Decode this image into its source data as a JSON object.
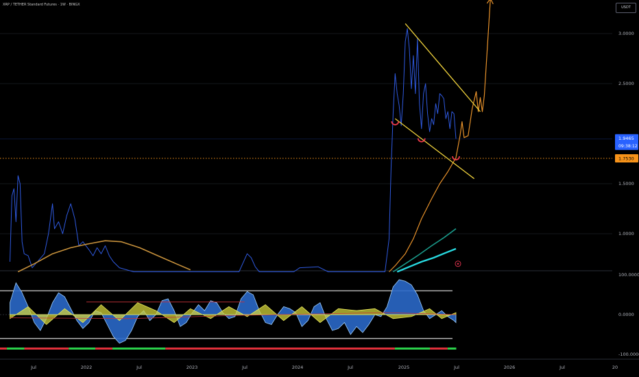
{
  "header": {
    "symbol_title": "XRP / TETHER Standard Futures · 1W · BINGX",
    "currency_button": "USDT"
  },
  "price_axis": {
    "ticks": [
      "3.0000",
      "2.5000",
      "1.5000",
      "1.0000"
    ],
    "current_price": "1.9465",
    "countdown": "09:38:12",
    "level_label": "1.7530",
    "colors": {
      "current": "#2962ff",
      "level": "#f7931a"
    }
  },
  "osc_axis": {
    "ticks": [
      "100.0000",
      "0.0000",
      "-100.0000"
    ]
  },
  "time_axis": {
    "ticks": [
      "Jul",
      "2022",
      "Jul",
      "2023",
      "Jul",
      "2024",
      "Jul",
      "2025",
      "Jul",
      "2026",
      "Jul",
      "20"
    ]
  },
  "chart_data": [
    {
      "type": "line",
      "panel": "price",
      "y_ticks": [
        1.0,
        1.5,
        2.5,
        3.0
      ],
      "ylim": [
        0.65,
        3.35
      ],
      "x_range": [
        "2021-04",
        "2026-12"
      ],
      "series": [
        {
          "color": "#2f5ae0",
          "values": [
            [
              "2021-04-12",
              0.72
            ],
            [
              "2021-04-19",
              1.38
            ],
            [
              "2021-04-26",
              1.45
            ],
            [
              "2021-05-03",
              1.12
            ],
            [
              "2021-05-10",
              1.58
            ],
            [
              "2021-05-17",
              1.5
            ],
            [
              "2021-05-24",
              0.92
            ],
            [
              "2021-05-31",
              0.8
            ],
            [
              "2021-06-14",
              0.78
            ],
            [
              "2021-06-28",
              0.66
            ],
            [
              "2021-08-09",
              0.8
            ],
            [
              "2021-08-23",
              1.0
            ],
            [
              "2021-09-06",
              1.3
            ],
            [
              "2021-09-13",
              1.05
            ],
            [
              "2021-09-27",
              1.12
            ],
            [
              "2021-10-11",
              1.0
            ],
            [
              "2021-10-25",
              1.18
            ],
            [
              "2021-11-08",
              1.3
            ],
            [
              "2021-11-22",
              1.15
            ],
            [
              "2021-12-06",
              0.88
            ],
            [
              "2021-12-20",
              0.92
            ],
            [
              "2022-01-10",
              0.84
            ],
            [
              "2022-01-24",
              0.78
            ],
            [
              "2022-02-07",
              0.86
            ],
            [
              "2022-02-21",
              0.8
            ],
            [
              "2022-03-07",
              0.88
            ],
            [
              "2022-03-21",
              0.78
            ],
            [
              "2022-04-04",
              0.72
            ],
            [
              "2022-04-25",
              0.66
            ],
            [
              "2022-06-13",
              0.62
            ],
            [
              "2022-12-26",
              0.62
            ],
            [
              "2023-06-12",
              0.62
            ],
            [
              "2023-07-10",
              0.8
            ],
            [
              "2023-07-24",
              0.76
            ],
            [
              "2023-08-07",
              0.67
            ],
            [
              "2023-08-21",
              0.62
            ],
            [
              "2023-12-18",
              0.62
            ],
            [
              "2024-01-08",
              0.66
            ],
            [
              "2024-03-11",
              0.67
            ],
            [
              "2024-04-15",
              0.62
            ],
            [
              "2024-10-28",
              0.62
            ],
            [
              "2024-11-11",
              0.95
            ],
            [
              "2024-11-18",
              1.65
            ],
            [
              "2024-11-25",
              2.2
            ],
            [
              "2024-12-02",
              2.6
            ],
            [
              "2024-12-09",
              2.4
            ],
            [
              "2024-12-16",
              2.28
            ],
            [
              "2024-12-23",
              2.08
            ],
            [
              "2024-12-30",
              2.4
            ],
            [
              "2025-01-06",
              2.92
            ],
            [
              "2025-01-13",
              3.05
            ],
            [
              "2025-01-20",
              2.85
            ],
            [
              "2025-01-27",
              2.45
            ],
            [
              "2025-02-03",
              2.78
            ],
            [
              "2025-02-10",
              2.4
            ],
            [
              "2025-02-17",
              2.95
            ],
            [
              "2025-02-24",
              2.3
            ],
            [
              "2025-03-03",
              2.05
            ],
            [
              "2025-03-10",
              2.4
            ],
            [
              "2025-03-17",
              2.5
            ],
            [
              "2025-03-24",
              2.2
            ],
            [
              "2025-03-31",
              2.02
            ],
            [
              "2025-04-07",
              2.15
            ],
            [
              "2025-04-14",
              2.09
            ],
            [
              "2025-04-21",
              2.3
            ],
            [
              "2025-04-28",
              2.2
            ],
            [
              "2025-05-05",
              2.4
            ],
            [
              "2025-05-12",
              2.38
            ],
            [
              "2025-05-19",
              2.35
            ],
            [
              "2025-05-26",
              2.15
            ],
            [
              "2025-06-02",
              2.22
            ],
            [
              "2025-06-09",
              2.05
            ],
            [
              "2025-06-16",
              2.22
            ],
            [
              "2025-06-23",
              2.2
            ],
            [
              "2025-06-30",
              1.95
            ]
          ]
        },
        {
          "color": "#c8923c",
          "values": [
            [
              "2021-05-10",
              0.62
            ],
            [
              "2021-07-05",
              0.7
            ],
            [
              "2021-09-06",
              0.8
            ],
            [
              "2021-11-08",
              0.86
            ],
            [
              "2022-01-10",
              0.9
            ],
            [
              "2022-03-07",
              0.93
            ],
            [
              "2022-05-02",
              0.92
            ],
            [
              "2022-07-04",
              0.86
            ],
            [
              "2022-09-05",
              0.78
            ],
            [
              "2022-11-07",
              0.7
            ],
            [
              "2022-12-26",
              0.64
            ]
          ]
        },
        {
          "color": "#e8922b",
          "values": [
            [
              "2024-11-11",
              0.62
            ],
            [
              "2024-12-02",
              0.68
            ],
            [
              "2025-01-06",
              0.8
            ],
            [
              "2025-02-03",
              0.95
            ],
            [
              "2025-03-03",
              1.15
            ],
            [
              "2025-04-07",
              1.35
            ],
            [
              "2025-05-05",
              1.5
            ],
            [
              "2025-06-02",
              1.62
            ],
            [
              "2025-06-30",
              1.76
            ]
          ]
        },
        {
          "color": "#1a9a8a",
          "values": [
            [
              "2024-11-25",
              0.62
            ],
            [
              "2025-01-06",
              0.7
            ],
            [
              "2025-02-17",
              0.78
            ],
            [
              "2025-04-07",
              0.88
            ],
            [
              "2025-05-19",
              0.96
            ],
            [
              "2025-06-30",
              1.05
            ]
          ]
        },
        {
          "color": "#28d9e0",
          "values": [
            [
              "2024-12-09",
              0.62
            ],
            [
              "2025-01-20",
              0.67
            ],
            [
              "2025-03-03",
              0.72
            ],
            [
              "2025-04-14",
              0.76
            ],
            [
              "2025-05-26",
              0.81
            ],
            [
              "2025-06-30",
              0.85
            ]
          ]
        },
        {
          "color": "#e8922b",
          "values": [
            [
              "2025-06-30",
              1.76
            ],
            [
              "2025-07-14",
              1.98
            ],
            [
              "2025-07-21",
              2.12
            ],
            [
              "2025-07-28",
              1.96
            ],
            [
              "2025-08-11",
              1.98
            ],
            [
              "2025-08-25",
              2.25
            ],
            [
              "2025-09-08",
              2.42
            ],
            [
              "2025-09-15",
              2.22
            ],
            [
              "2025-09-22",
              2.36
            ],
            [
              "2025-09-29",
              2.22
            ],
            [
              "2025-10-06",
              2.38
            ],
            [
              "2025-10-27",
              3.35
            ]
          ]
        }
      ],
      "trendlines": [
        {
          "color": "#f0d23c",
          "from": [
            "2025-01-06",
            3.1
          ],
          "to": [
            "2025-09-22",
            2.22
          ]
        },
        {
          "color": "#f0d23c",
          "from": [
            "2024-12-02",
            2.15
          ],
          "to": [
            "2025-09-01",
            1.55
          ]
        }
      ],
      "markers": [
        {
          "shape": "arc",
          "color": "#ef3a4a",
          "at": [
            "2024-12-02",
            2.11
          ]
        },
        {
          "shape": "arc",
          "color": "#ef3a4a",
          "at": [
            "2025-03-03",
            1.94
          ]
        },
        {
          "shape": "arc",
          "color": "#ef3a4a",
          "at": [
            "2025-06-30",
            1.76
          ]
        },
        {
          "shape": "circle",
          "color": "#d6304a",
          "at": [
            "2025-07-07",
            0.7
          ]
        }
      ],
      "levels": [
        {
          "price": 1.753,
          "color": "#f7931a",
          "style": "dotted"
        },
        {
          "price": 1.9465,
          "color": "#2962ff",
          "style": "solid"
        }
      ]
    },
    {
      "type": "area",
      "panel": "oscillator",
      "y_ticks": [
        100,
        0,
        -100
      ],
      "ylim": [
        -110,
        110
      ],
      "reference_lines": [
        60,
        -60
      ],
      "x_range": [
        "2021-04",
        "2026-12"
      ],
      "series": [
        {
          "color": "#2a68c8",
          "values": [
            [
              "2021-04-12",
              30
            ],
            [
              "2021-05-03",
              80
            ],
            [
              "2021-05-24",
              55
            ],
            [
              "2021-06-14",
              20
            ],
            [
              "2021-07-05",
              -20
            ],
            [
              "2021-07-26",
              -40
            ],
            [
              "2021-08-16",
              -10
            ],
            [
              "2021-09-06",
              30
            ],
            [
              "2021-09-27",
              55
            ],
            [
              "2021-10-18",
              45
            ],
            [
              "2021-11-08",
              15
            ],
            [
              "2021-11-29",
              -15
            ],
            [
              "2021-12-20",
              -35
            ],
            [
              "2022-01-10",
              -20
            ],
            [
              "2022-01-31",
              10
            ],
            [
              "2022-02-21",
              5
            ],
            [
              "2022-03-14",
              -25
            ],
            [
              "2022-04-04",
              -55
            ],
            [
              "2022-04-25",
              -72
            ],
            [
              "2022-05-16",
              -65
            ],
            [
              "2022-06-06",
              -40
            ],
            [
              "2022-06-27",
              -5
            ],
            [
              "2022-07-18",
              10
            ],
            [
              "2022-08-08",
              -15
            ],
            [
              "2022-08-29",
              0
            ],
            [
              "2022-09-19",
              35
            ],
            [
              "2022-10-10",
              40
            ],
            [
              "2022-10-31",
              10
            ],
            [
              "2022-11-21",
              -30
            ],
            [
              "2022-12-12",
              -20
            ],
            [
              "2023-01-02",
              5
            ],
            [
              "2023-01-23",
              25
            ],
            [
              "2023-02-13",
              10
            ],
            [
              "2023-03-06",
              35
            ],
            [
              "2023-03-27",
              30
            ],
            [
              "2023-04-17",
              5
            ],
            [
              "2023-05-08",
              -10
            ],
            [
              "2023-05-29",
              -5
            ],
            [
              "2023-06-19",
              40
            ],
            [
              "2023-07-10",
              58
            ],
            [
              "2023-07-31",
              50
            ],
            [
              "2023-08-21",
              10
            ],
            [
              "2023-09-11",
              -20
            ],
            [
              "2023-10-02",
              -25
            ],
            [
              "2023-10-23",
              0
            ],
            [
              "2023-11-13",
              20
            ],
            [
              "2023-12-04",
              15
            ],
            [
              "2023-12-25",
              5
            ],
            [
              "2024-01-15",
              -30
            ],
            [
              "2024-02-05",
              -15
            ],
            [
              "2024-02-26",
              20
            ],
            [
              "2024-03-18",
              30
            ],
            [
              "2024-04-08",
              -10
            ],
            [
              "2024-04-29",
              -40
            ],
            [
              "2024-05-20",
              -35
            ],
            [
              "2024-06-10",
              -20
            ],
            [
              "2024-07-01",
              -50
            ],
            [
              "2024-07-22",
              -30
            ],
            [
              "2024-08-12",
              -45
            ],
            [
              "2024-09-02",
              -25
            ],
            [
              "2024-09-23",
              0
            ],
            [
              "2024-10-14",
              -5
            ],
            [
              "2024-11-04",
              20
            ],
            [
              "2024-11-25",
              70
            ],
            [
              "2024-12-16",
              88
            ],
            [
              "2025-01-06",
              84
            ],
            [
              "2025-01-27",
              75
            ],
            [
              "2025-02-17",
              50
            ],
            [
              "2025-03-10",
              10
            ],
            [
              "2025-03-31",
              -10
            ],
            [
              "2025-04-21",
              0
            ],
            [
              "2025-05-12",
              10
            ],
            [
              "2025-06-02",
              -5
            ],
            [
              "2025-06-23",
              -15
            ],
            [
              "2025-06-30",
              -20
            ]
          ]
        },
        {
          "color": "#d2d23a",
          "values": [
            [
              "2021-04-12",
              -10
            ],
            [
              "2021-06-14",
              20
            ],
            [
              "2021-08-16",
              -25
            ],
            [
              "2021-10-18",
              15
            ],
            [
              "2021-12-20",
              -20
            ],
            [
              "2022-02-21",
              25
            ],
            [
              "2022-04-25",
              -15
            ],
            [
              "2022-06-27",
              30
            ],
            [
              "2022-08-29",
              10
            ],
            [
              "2022-10-31",
              -20
            ],
            [
              "2022-12-26",
              15
            ],
            [
              "2023-03-06",
              -10
            ],
            [
              "2023-05-08",
              20
            ],
            [
              "2023-07-10",
              -5
            ],
            [
              "2023-09-11",
              25
            ],
            [
              "2023-11-13",
              -15
            ],
            [
              "2024-01-15",
              20
            ],
            [
              "2024-03-18",
              -20
            ],
            [
              "2024-05-20",
              15
            ],
            [
              "2024-07-22",
              10
            ],
            [
              "2024-09-23",
              15
            ],
            [
              "2024-11-25",
              -10
            ],
            [
              "2025-01-27",
              -5
            ],
            [
              "2025-03-31",
              15
            ],
            [
              "2025-05-12",
              -10
            ],
            [
              "2025-06-30",
              5
            ]
          ]
        }
      ]
    }
  ]
}
